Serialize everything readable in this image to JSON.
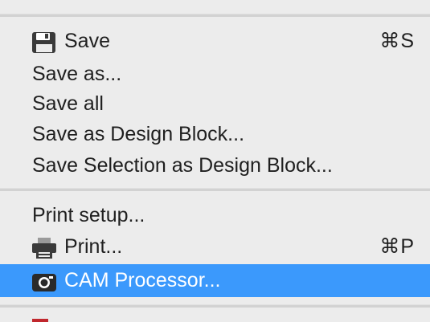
{
  "menu": {
    "items": [
      {
        "label": "Save",
        "shortcut": "⌘S",
        "icon": "floppy-disk-icon"
      },
      {
        "label": "Save as..."
      },
      {
        "label": "Save all"
      },
      {
        "label": "Save as Design Block..."
      },
      {
        "label": "Save Selection as Design Block..."
      },
      {
        "label": "Print setup..."
      },
      {
        "label": "Print...",
        "shortcut": "⌘P",
        "icon": "printer-icon"
      },
      {
        "label": "CAM Processor...",
        "icon": "camera-icon",
        "highlighted": true
      }
    ]
  },
  "colors": {
    "menu_background": "#ececec",
    "highlight": "#3b99fc",
    "separator": "#d2d2d2",
    "text": "#1f1f1f"
  }
}
